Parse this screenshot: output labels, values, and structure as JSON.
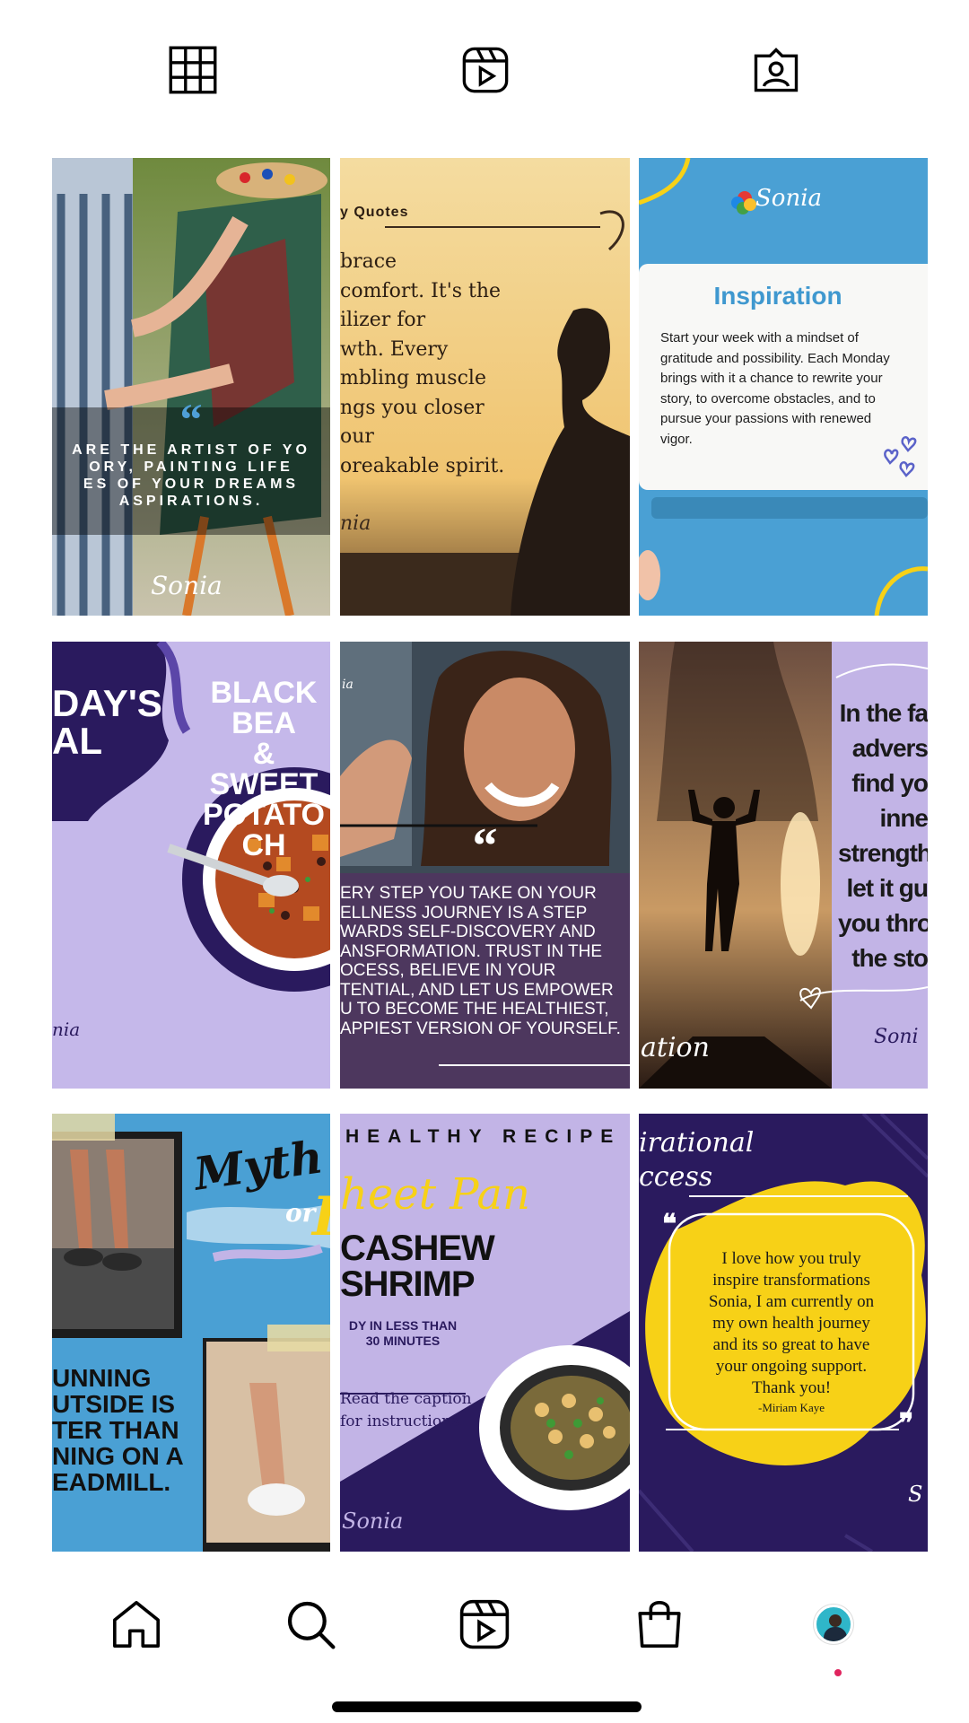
{
  "tabs": [
    {
      "name": "grid",
      "icon": "grid-icon"
    },
    {
      "name": "reels",
      "icon": "reels-icon"
    },
    {
      "name": "tagged",
      "icon": "tagged-icon"
    }
  ],
  "posts": {
    "p1": {
      "quote_mark": "“",
      "lines": [
        "ARE THE ARTIST OF YO",
        "ORY, PAINTING LIFE",
        "ES OF YOUR DREAMS",
        "ASPIRATIONS."
      ],
      "logo": "Sonia"
    },
    "p2": {
      "header": "y Quotes",
      "lines": [
        "brace",
        "comfort. It's the",
        "ilizer for",
        "wth. Every",
        "mbling muscle",
        "ngs you closer",
        "our",
        "oreakable spirit."
      ],
      "logo": "nia"
    },
    "p3": {
      "logo": "Sonia",
      "title": "Inspiration",
      "body": [
        "Start your week with a mindset of",
        "gratitude and possibility. Each Monday",
        "brings with it a chance to rewrite your",
        "story, to overcome obstacles, and to",
        "pursue your passions with renewed",
        "vigor."
      ]
    },
    "p4": {
      "left_lines": [
        "DAY'S",
        "AL"
      ],
      "title_lines": [
        "BLACK BEA",
        "& SWEET",
        "POTATO CH"
      ],
      "logo": "nia"
    },
    "p5": {
      "logo": "ia",
      "quote_mark": "“",
      "lines": [
        "ERY STEP YOU TAKE ON YOUR",
        "ELLNESS JOURNEY IS A STEP",
        "WARDS SELF-DISCOVERY AND",
        "ANSFORMATION. TRUST IN THE",
        "OCESS, BELIEVE IN YOUR",
        "TENTIAL, AND LET US EMPOWER",
        "U TO BECOME THE HEALTHIEST,",
        "APPIEST VERSION OF YOURSELF."
      ]
    },
    "p6": {
      "lines": [
        "In the fa",
        "advers",
        "find yo",
        "inne",
        "strength",
        "let it gu",
        "you thro",
        "the sto"
      ],
      "script": "ation",
      "logo": "Soni"
    },
    "p7": {
      "script_a": "Myth",
      "script_b": "or",
      "script_c": "F",
      "lines": [
        "UNNING",
        "UTSIDE IS",
        "TER THAN",
        "NING ON A",
        "EADMILL."
      ]
    },
    "p8": {
      "header": "HEALTHY RECIPE",
      "script": "heet Pan",
      "title_lines": [
        "CASHEW",
        "SHRIMP"
      ],
      "sub_lines": [
        "DY IN LESS THAN",
        "30 MINUTES"
      ],
      "note_lines": [
        "Read the caption",
        "for instructions"
      ],
      "logo": "Sonia"
    },
    "p9": {
      "script_lines": [
        "irational",
        "ccess"
      ],
      "lines": [
        "I love how you truly",
        "inspire transformations",
        "Sonia, I am currently on",
        "my own health journey",
        "and its so great to have",
        "your ongoing support.",
        "Thank you!"
      ],
      "signature": "-Miriam Kaye",
      "logo": "S"
    }
  },
  "nav": [
    {
      "name": "home",
      "icon": "home-icon"
    },
    {
      "name": "search",
      "icon": "search-icon"
    },
    {
      "name": "reels",
      "icon": "reels-icon"
    },
    {
      "name": "shop",
      "icon": "shopping-bag-icon"
    },
    {
      "name": "profile",
      "icon": "profile-avatar"
    }
  ],
  "colors": {
    "lavender": "#c2b4e6",
    "navy": "#2a1a5e",
    "sky": "#3f98cf",
    "yellow": "#f7d117",
    "cream": "#fbf4e4",
    "accent_red": "#e0245e"
  }
}
